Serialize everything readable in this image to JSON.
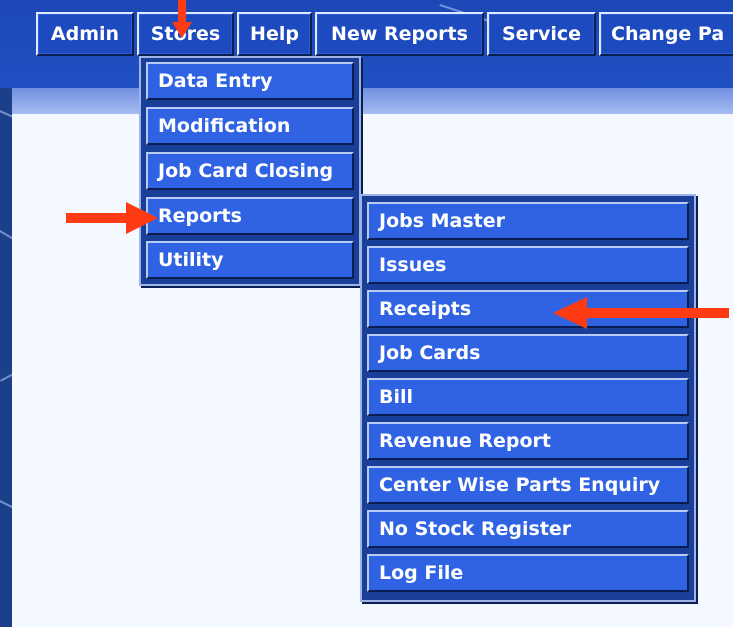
{
  "menubar": {
    "items": [
      "Admin",
      "Stores",
      "Help",
      "New Reports",
      "Service",
      "Change Pa"
    ]
  },
  "stores_menu": {
    "items": [
      "Data Entry",
      "Modification",
      "Job Card Closing",
      "Reports",
      "Utility"
    ]
  },
  "reports_menu": {
    "items": [
      "Jobs Master",
      "Issues",
      "Receipts",
      "Job Cards",
      "Bill",
      "Revenue Report",
      "Center Wise Parts Enquiry",
      "No Stock Register",
      "Log File"
    ]
  },
  "colors": {
    "menu_blue": "#2f63e3",
    "arrow_red": "#ff3b14"
  }
}
